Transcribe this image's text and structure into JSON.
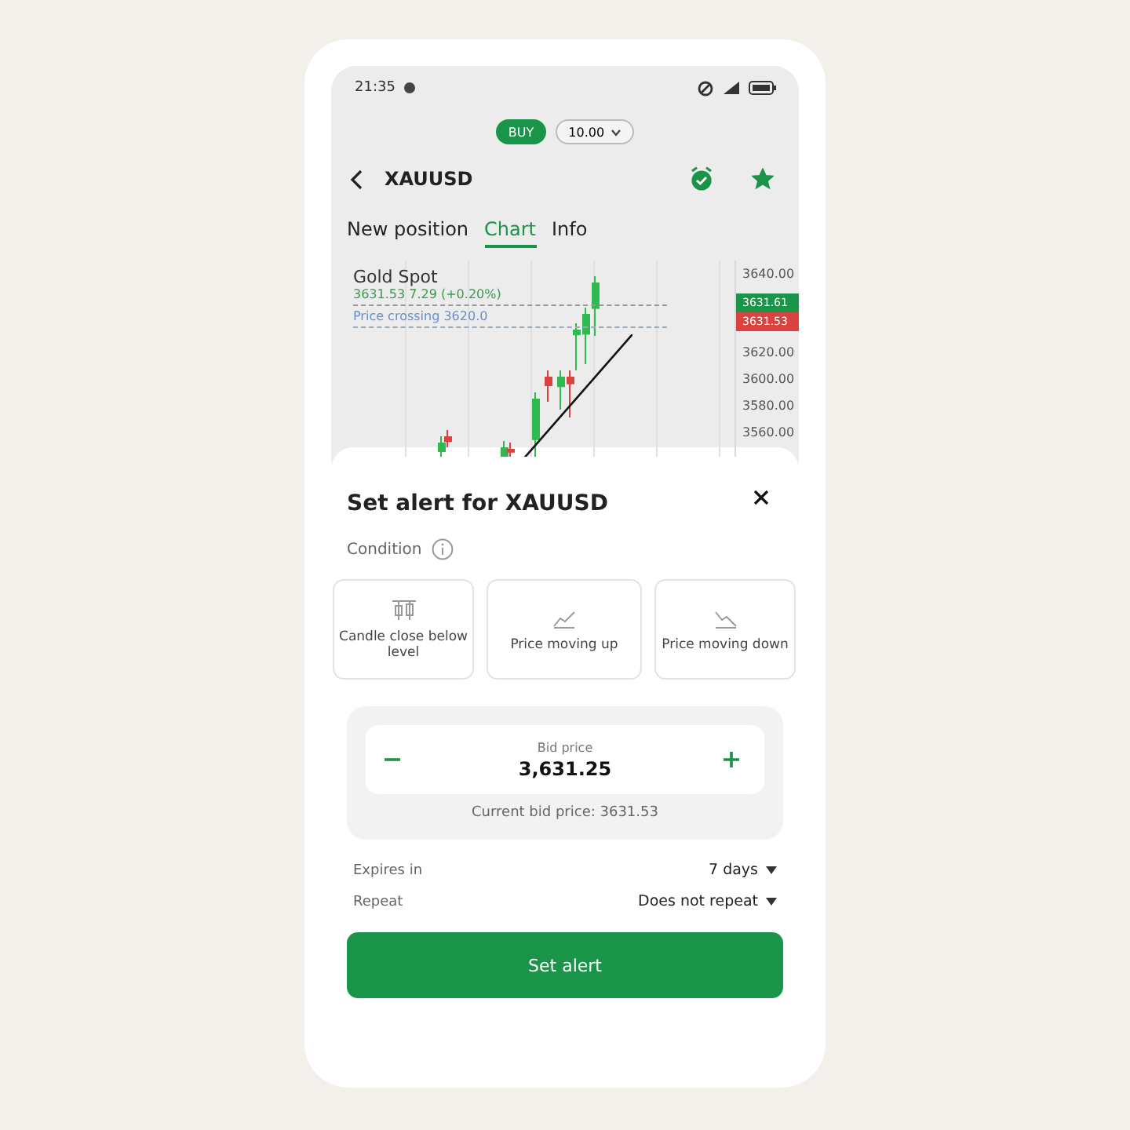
{
  "status_bar": {
    "time": "21:35"
  },
  "trade_bar": {
    "side": "BUY",
    "amount": "10.00"
  },
  "header": {
    "symbol": "XAUUSD",
    "alert_set": true,
    "favorite": true
  },
  "tabs": [
    {
      "label": "New position",
      "selected": false
    },
    {
      "label": "Chart",
      "selected": true
    },
    {
      "label": "Info",
      "selected": false
    }
  ],
  "chart": {
    "title": "Gold Spot",
    "quote": "3631.53 7.29 (+0.20%)",
    "crossing": "Price crossing 3620.0",
    "ask_tag": "3631.61",
    "bid_tag": "3631.53",
    "axis_labels": [
      "3640.00",
      "3620.00",
      "3600.00",
      "3580.00",
      "3560.00"
    ]
  },
  "sheet": {
    "title": "Set alert for XAUUSD",
    "condition_label": "Condition",
    "conditions": [
      {
        "kind": "candle",
        "label": "Candle close below level",
        "selected": false
      },
      {
        "kind": "up",
        "label": "Price moving up",
        "selected": false
      },
      {
        "kind": "down",
        "label": "Price moving down",
        "selected": false
      }
    ],
    "price": {
      "label": "Bid price",
      "value": "3,631.25",
      "current": "Current bid price: 3631.53"
    },
    "options": [
      {
        "label": "Expires in",
        "value": "7 days"
      },
      {
        "label": "Repeat",
        "value": "Does not repeat"
      }
    ],
    "submit": "Set alert"
  }
}
